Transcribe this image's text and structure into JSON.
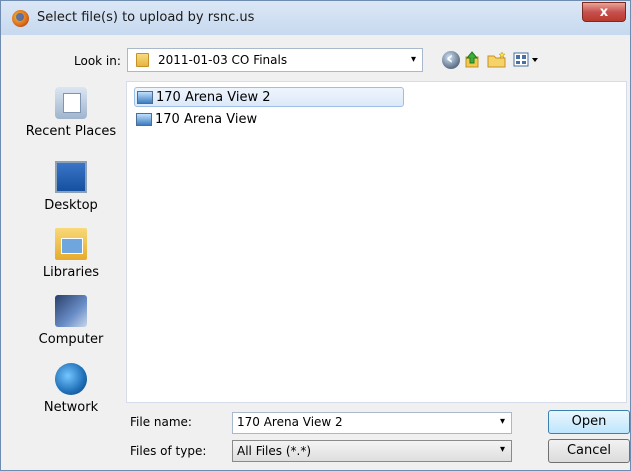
{
  "window": {
    "title": "Select file(s) to upload by rsnc.us",
    "close_label": "x"
  },
  "toolbar": {
    "look_in_label": "Look in:",
    "look_in_value": "2011-01-03 CO Finals",
    "dropdown_arrow": "▾"
  },
  "places": [
    {
      "label": "Recent Places",
      "icon": "recent-places-icon"
    },
    {
      "label": "Desktop",
      "icon": "desktop-icon"
    },
    {
      "label": "Libraries",
      "icon": "libraries-icon"
    },
    {
      "label": "Computer",
      "icon": "computer-icon"
    },
    {
      "label": "Network",
      "icon": "network-icon"
    }
  ],
  "files": [
    {
      "name": "170 Arena View 2",
      "selected": true
    },
    {
      "name": "170 Arena View",
      "selected": false
    }
  ],
  "form": {
    "file_name_label": "File name:",
    "file_name_value": "170 Arena View 2",
    "files_of_type_label": "Files of type:",
    "files_of_type_value": "All Files (*.*)",
    "open_label": "Open",
    "cancel_label": "Cancel"
  }
}
